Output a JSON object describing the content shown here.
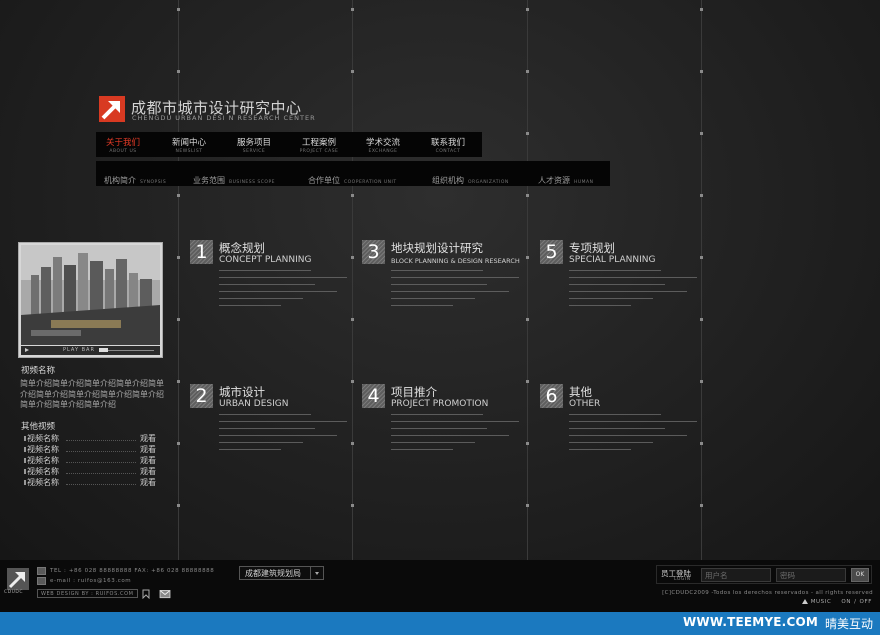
{
  "header": {
    "title_cn": "成都市城市设计研究中心",
    "title_en": "CHENGDU URBAN DESI N RESEARCH CENTER"
  },
  "nav": {
    "items": [
      {
        "cn": "关于我们",
        "en": "ABOUT US",
        "active": true
      },
      {
        "cn": "新闻中心",
        "en": "NEWSLIST",
        "active": false
      },
      {
        "cn": "服务项目",
        "en": "SERVICE",
        "active": false
      },
      {
        "cn": "工程案例",
        "en": "PROJECT CASE",
        "active": false
      },
      {
        "cn": "学术交流",
        "en": "EXCHANGE",
        "active": false
      },
      {
        "cn": "联系我们",
        "en": "CONTACT",
        "active": false
      }
    ],
    "sub_items": [
      {
        "cn": "机构简介",
        "en": "SYNOPSIS"
      },
      {
        "cn": "业务范围",
        "en": "BUSINESS SCOPE"
      },
      {
        "cn": "合作单位",
        "en": "COOPERATION UNIT"
      },
      {
        "cn": "组织机构",
        "en": "ORGANIZATION"
      },
      {
        "cn": "人才资源",
        "en": "HUMAN"
      }
    ]
  },
  "video": {
    "play_bar_label": "PLAY BAR",
    "name": "视频名称",
    "intro": "简单介绍简单介绍简单介绍简单介绍简单介绍简单介绍简单介绍简单介绍简单介绍简单介绍简单介绍简单介绍"
  },
  "other_videos": {
    "title": "其他视频",
    "items": [
      {
        "name": "视频名称",
        "action": "观看"
      },
      {
        "name": "视频名称",
        "action": "观看"
      },
      {
        "name": "视频名称",
        "action": "观看"
      },
      {
        "name": "视频名称",
        "action": "观看"
      },
      {
        "name": "视频名称",
        "action": "观看"
      }
    ]
  },
  "categories": [
    {
      "num": "1",
      "cn": "概念规划",
      "en": "CONCEPT PLANNING"
    },
    {
      "num": "3",
      "cn": "地块规划设计研究",
      "en": "BLOCK PLANNING & DESIGN RESEARCH"
    },
    {
      "num": "5",
      "cn": "专项规划",
      "en": "SPECIAL PLANNING"
    },
    {
      "num": "2",
      "cn": "城市设计",
      "en": "URBAN DESIGN"
    },
    {
      "num": "4",
      "cn": "项目推介",
      "en": "PROJECT PROMOTION"
    },
    {
      "num": "6",
      "cn": "其他",
      "en": "OTHER"
    }
  ],
  "footer": {
    "logo_label": "CDUDC",
    "tel": "TEL : +86 028 88888888    FAX: +86 028 88888888",
    "email": "e-mail : ruifos@163.com",
    "web_design": "WEB DESIGN BY : RUIFOS.COM",
    "site_select": "成都建筑规划局",
    "login": {
      "label": "员工登陆",
      "label_en": "LOGIN",
      "username_placeholder": "用户名",
      "password_placeholder": "密码",
      "ok": "OK"
    },
    "copyright": "[C]CDUDC2009 -Todos los derechos reservados - all rights reserved",
    "music_label": "MUSIC",
    "music_on": "ON",
    "music_sep": "/",
    "music_off": "OFF"
  },
  "brand_bar": {
    "url": "WWW.TEEMYE.COM",
    "name": "晴美互动"
  },
  "colors": {
    "accent": "#e43b27",
    "brand_bar": "#1b79bf",
    "background": "#232323"
  }
}
